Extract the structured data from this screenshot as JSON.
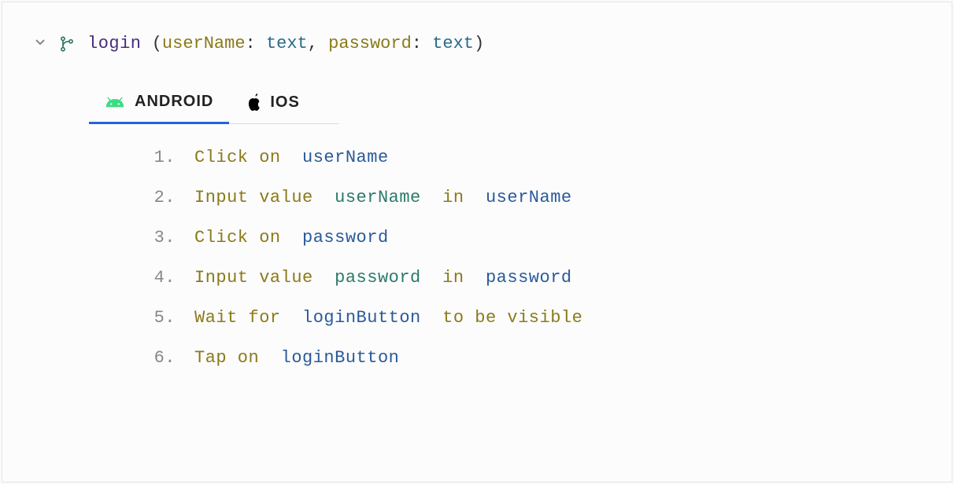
{
  "header": {
    "function_name": "login",
    "params": [
      {
        "name": "userName",
        "type": "text"
      },
      {
        "name": "password",
        "type": "text"
      }
    ]
  },
  "tabs": [
    {
      "id": "android",
      "label": "ANDROID",
      "active": true
    },
    {
      "id": "ios",
      "label": "IOS",
      "active": false
    }
  ],
  "steps": [
    {
      "num": "1.",
      "parts": [
        {
          "text": "Click on ",
          "cls": "action"
        },
        {
          "text": " userName",
          "cls": "arg-blue"
        }
      ]
    },
    {
      "num": "2.",
      "parts": [
        {
          "text": "Input value ",
          "cls": "action"
        },
        {
          "text": " userName ",
          "cls": "arg-teal"
        },
        {
          "text": " in ",
          "cls": "kw"
        },
        {
          "text": " userName",
          "cls": "arg-blue"
        }
      ]
    },
    {
      "num": "3.",
      "parts": [
        {
          "text": "Click on ",
          "cls": "action"
        },
        {
          "text": " password",
          "cls": "arg-blue"
        }
      ]
    },
    {
      "num": "4.",
      "parts": [
        {
          "text": "Input value ",
          "cls": "action"
        },
        {
          "text": " password ",
          "cls": "arg-teal"
        },
        {
          "text": " in ",
          "cls": "kw"
        },
        {
          "text": " password",
          "cls": "arg-blue"
        }
      ]
    },
    {
      "num": "5.",
      "parts": [
        {
          "text": "Wait for ",
          "cls": "action"
        },
        {
          "text": " loginButton ",
          "cls": "arg-blue"
        },
        {
          "text": " to be visible",
          "cls": "kw"
        }
      ]
    },
    {
      "num": "6.",
      "parts": [
        {
          "text": "Tap on ",
          "cls": "action"
        },
        {
          "text": " loginButton",
          "cls": "arg-blue"
        }
      ]
    }
  ]
}
